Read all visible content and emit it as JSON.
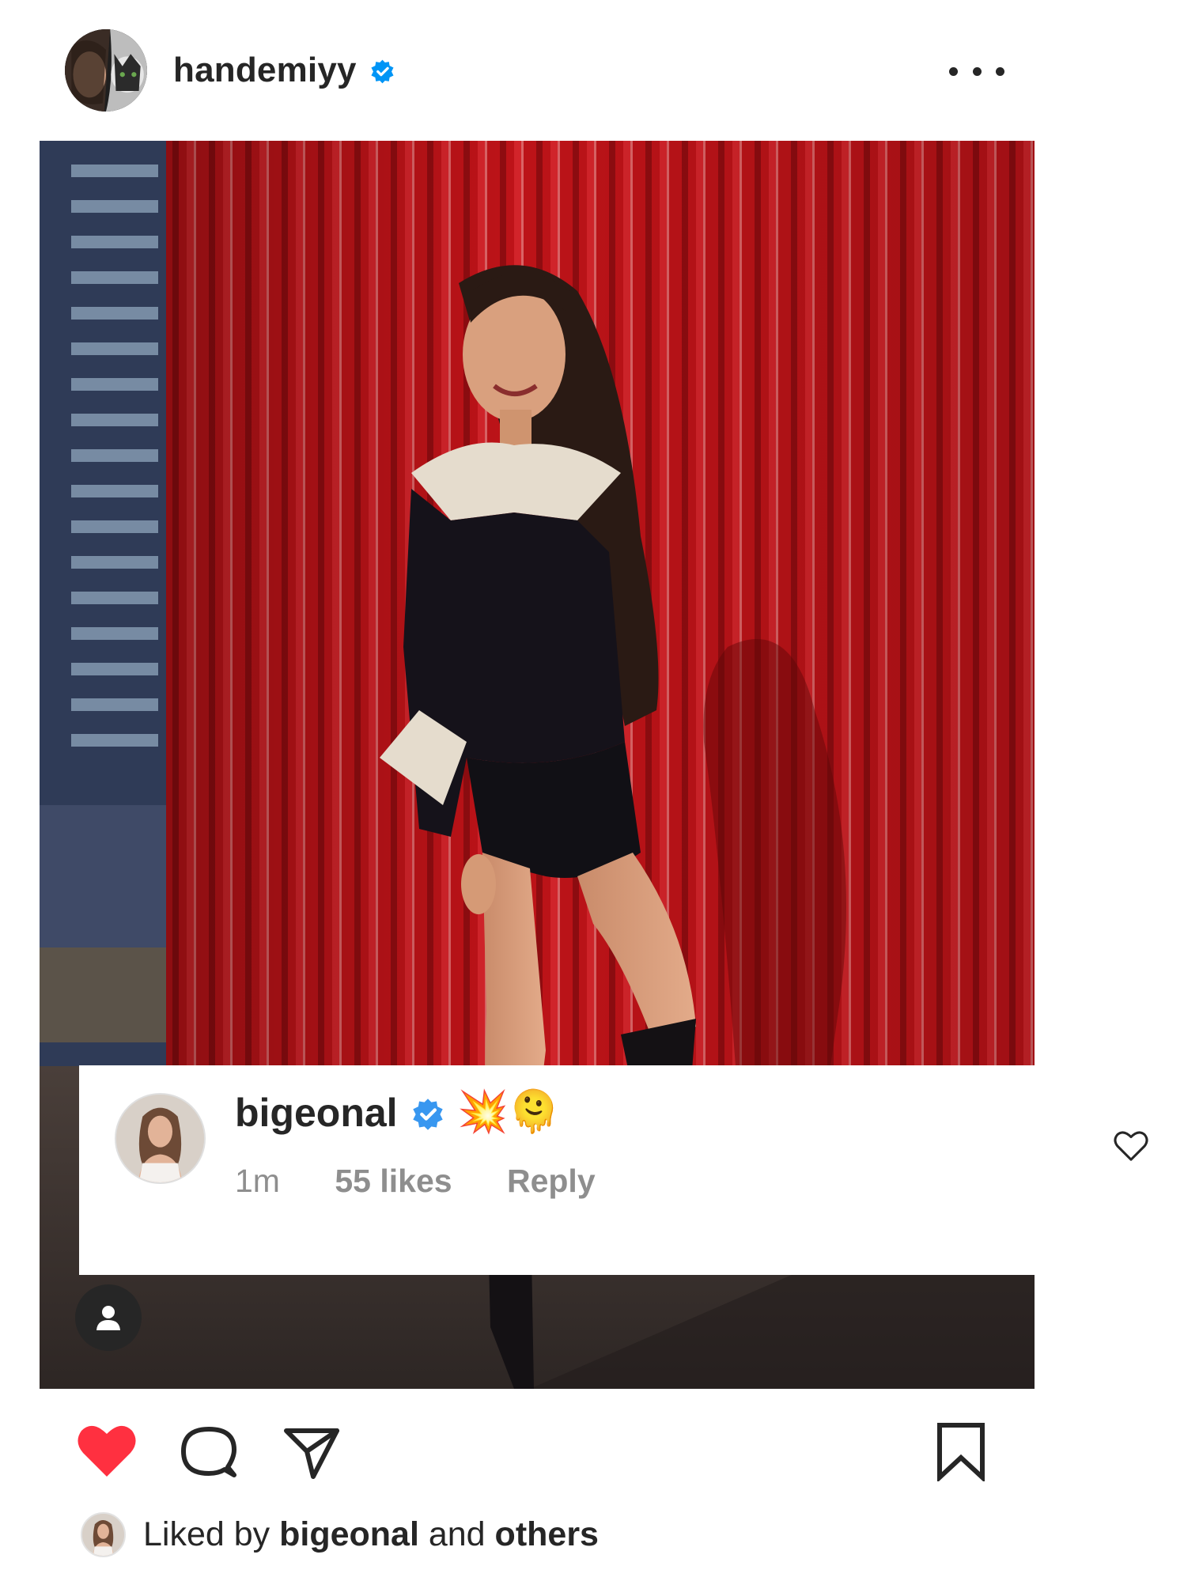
{
  "post": {
    "username": "handemiyy",
    "verified": true,
    "image_alt": "",
    "more_icon": "more-horizontal-icon"
  },
  "comment": {
    "username": "bigeonal",
    "verified": true,
    "text": "💥🫠",
    "time": "1m",
    "likes": "55 likes",
    "reply_label": "Reply"
  },
  "actions": {
    "liked": true,
    "like_icon": "heart-filled-icon",
    "comment_icon": "comment-bubble-icon",
    "share_icon": "paper-plane-icon",
    "save_icon": "bookmark-icon",
    "tag_icon": "person-tag-icon"
  },
  "likes_summary": {
    "prefix": "Liked by ",
    "user": "bigeonal",
    "connector": " and ",
    "suffix": "others"
  },
  "colors": {
    "like_red": "#ff3040",
    "text_primary": "#262626",
    "text_secondary": "#8e8e8e",
    "verified_blue": "#0095f6",
    "wall_red": "#c3161c"
  }
}
